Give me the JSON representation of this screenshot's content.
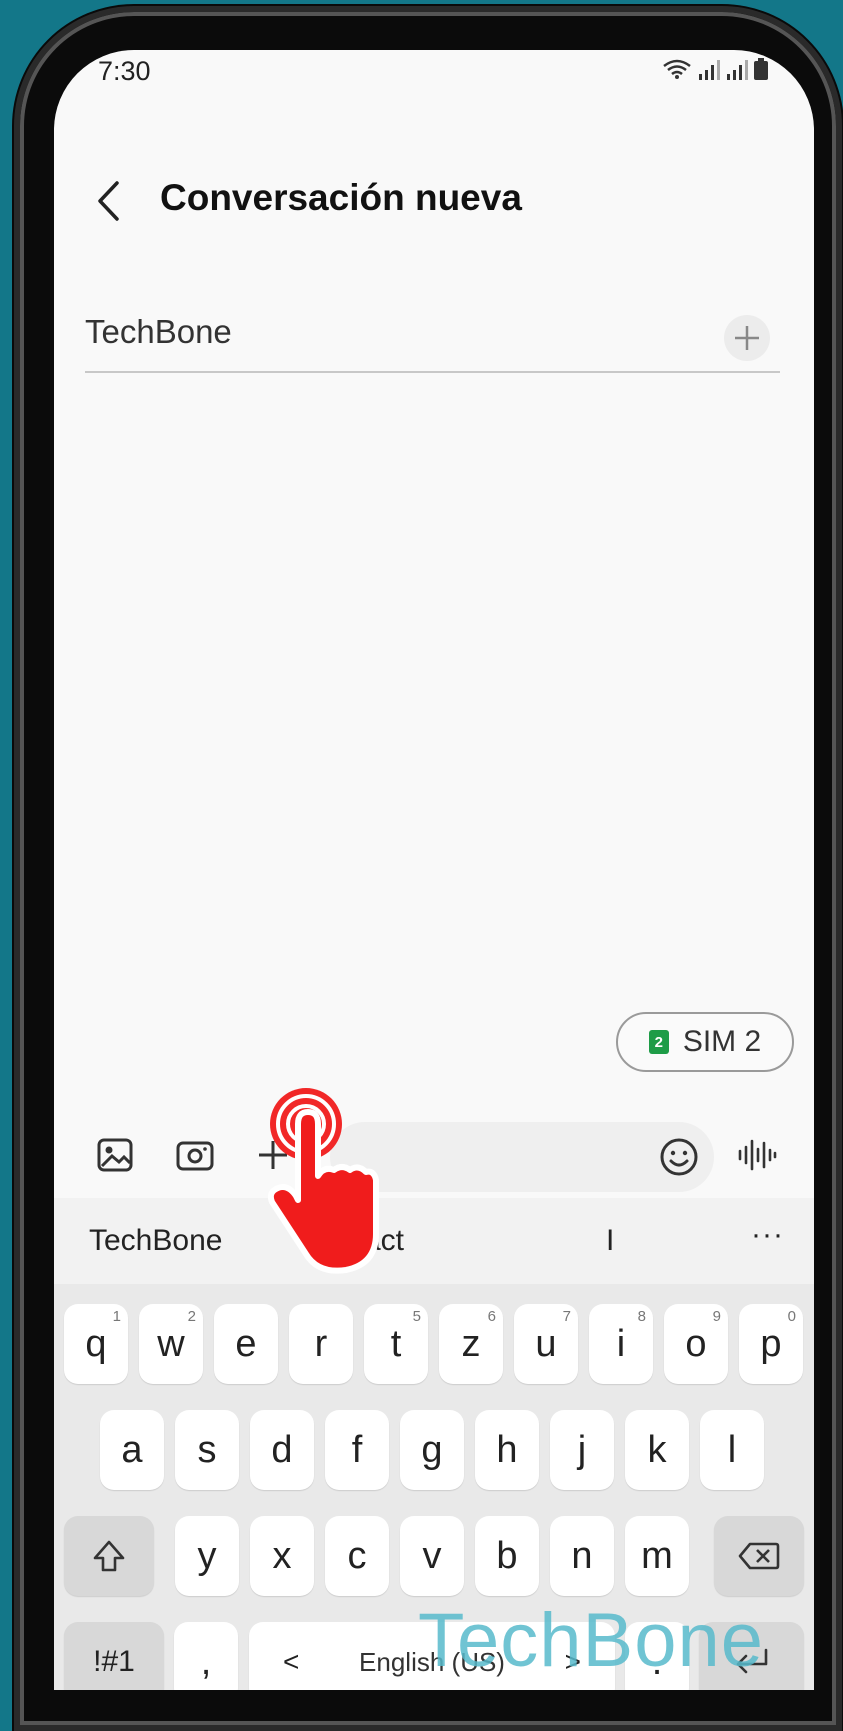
{
  "status_bar": {
    "time": "7:30"
  },
  "header": {
    "title": "Conversación nueva"
  },
  "recipient": {
    "value": "TechBone"
  },
  "sim": {
    "label": "SIM 2",
    "badge": "2"
  },
  "suggestions": {
    "items": [
      "TechBone",
      "act",
      "I"
    ],
    "more": "···"
  },
  "keyboard": {
    "row1": [
      {
        "k": "q",
        "h": "1"
      },
      {
        "k": "w",
        "h": "2"
      },
      {
        "k": "e",
        "h": ""
      },
      {
        "k": "r",
        "h": ""
      },
      {
        "k": "t",
        "h": "5"
      },
      {
        "k": "z",
        "h": "6"
      },
      {
        "k": "u",
        "h": "7"
      },
      {
        "k": "i",
        "h": "8"
      },
      {
        "k": "o",
        "h": "9"
      },
      {
        "k": "p",
        "h": "0"
      }
    ],
    "row2": [
      "a",
      "s",
      "d",
      "f",
      "g",
      "h",
      "j",
      "k",
      "l"
    ],
    "row3": [
      "y",
      "x",
      "c",
      "v",
      "b",
      "n",
      "m"
    ],
    "symbols_label": "!#1",
    "comma_label": ",",
    "space_label": "English (US)",
    "period_label": ".",
    "left_arrow": "<",
    "right_arrow": ">"
  },
  "watermark": "TechBone",
  "colors": {
    "background": "#137789",
    "tap_indicator": "#f01c1c",
    "sim_green": "#1e9c47"
  }
}
